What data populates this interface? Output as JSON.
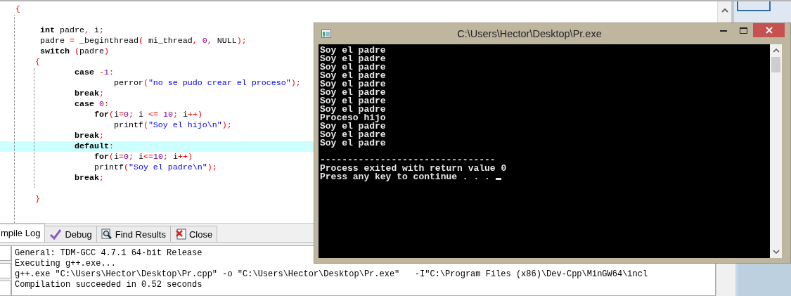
{
  "editor": {
    "lines": [
      {
        "current": false,
        "segments": [
          {
            "kind": "sym",
            "t": "{"
          }
        ]
      },
      {
        "current": false
      },
      {
        "current": false,
        "segments": [
          {
            "kind": "kw",
            "t": "     int"
          },
          {
            "kind": "id",
            "t": " padre"
          },
          {
            "kind": "sym",
            "t": ","
          },
          {
            "kind": "id",
            "t": " i"
          },
          {
            "kind": "sym",
            "t": ";"
          }
        ]
      },
      {
        "current": false,
        "segments": [
          {
            "kind": "id",
            "t": "     padre "
          },
          {
            "kind": "sym",
            "t": "="
          },
          {
            "kind": "id",
            "t": " _beginthread"
          },
          {
            "kind": "sym",
            "t": "("
          },
          {
            "kind": "id",
            "t": " mi_thread"
          },
          {
            "kind": "sym",
            "t": ","
          },
          {
            "kind": "num",
            "t": " 0"
          },
          {
            "kind": "sym",
            "t": ","
          },
          {
            "kind": "id",
            "t": " NULL"
          },
          {
            "kind": "sym",
            "t": ");"
          }
        ]
      },
      {
        "current": false,
        "segments": [
          {
            "kind": "kw",
            "t": "     switch"
          },
          {
            "kind": "sym",
            "t": " ("
          },
          {
            "kind": "id",
            "t": "padre"
          },
          {
            "kind": "sym",
            "t": ")"
          }
        ]
      },
      {
        "current": false,
        "segments": [
          {
            "kind": "sym",
            "t": "    {"
          }
        ]
      },
      {
        "current": false,
        "segments": [
          {
            "kind": "kw",
            "t": "            case"
          },
          {
            "kind": "sym",
            "t": " -"
          },
          {
            "kind": "num",
            "t": "1"
          },
          {
            "kind": "sym",
            "t": ":"
          }
        ]
      },
      {
        "current": false,
        "segments": [
          {
            "kind": "id",
            "t": "                    perror"
          },
          {
            "kind": "sym",
            "t": "("
          },
          {
            "kind": "str",
            "t": "\"no se pudo crear el proceso\""
          },
          {
            "kind": "sym",
            "t": ");"
          }
        ]
      },
      {
        "current": false,
        "segments": [
          {
            "kind": "kw",
            "t": "            break"
          },
          {
            "kind": "sym",
            "t": ";"
          }
        ]
      },
      {
        "current": false,
        "segments": [
          {
            "kind": "kw",
            "t": "            case"
          },
          {
            "kind": "num",
            "t": " 0"
          },
          {
            "kind": "sym",
            "t": ":"
          }
        ]
      },
      {
        "current": false,
        "segments": [
          {
            "kind": "kw",
            "t": "                for"
          },
          {
            "kind": "sym",
            "t": "("
          },
          {
            "kind": "id",
            "t": "i"
          },
          {
            "kind": "sym",
            "t": "="
          },
          {
            "kind": "num",
            "t": "0"
          },
          {
            "kind": "sym",
            "t": ";"
          },
          {
            "kind": "id",
            "t": " i "
          },
          {
            "kind": "sym",
            "t": "<="
          },
          {
            "kind": "num",
            "t": " 10"
          },
          {
            "kind": "sym",
            "t": ";"
          },
          {
            "kind": "id",
            "t": " i"
          },
          {
            "kind": "sym",
            "t": "++)"
          }
        ]
      },
      {
        "current": false,
        "segments": [
          {
            "kind": "id",
            "t": "                    printf"
          },
          {
            "kind": "sym",
            "t": "("
          },
          {
            "kind": "str",
            "t": "\"Soy el hijo\\n\""
          },
          {
            "kind": "sym",
            "t": ");"
          }
        ]
      },
      {
        "current": false,
        "segments": [
          {
            "kind": "kw",
            "t": "            break"
          },
          {
            "kind": "sym",
            "t": ";"
          }
        ]
      },
      {
        "current": true,
        "segments": [
          {
            "kind": "kw",
            "t": "            default"
          },
          {
            "kind": "sym",
            "t": ":"
          }
        ]
      },
      {
        "current": false,
        "segments": [
          {
            "kind": "kw",
            "t": "                for"
          },
          {
            "kind": "sym",
            "t": "("
          },
          {
            "kind": "id",
            "t": "i"
          },
          {
            "kind": "sym",
            "t": "="
          },
          {
            "kind": "num",
            "t": "0"
          },
          {
            "kind": "sym",
            "t": ";"
          },
          {
            "kind": "id",
            "t": " i"
          },
          {
            "kind": "sym",
            "t": "<="
          },
          {
            "kind": "num",
            "t": "10"
          },
          {
            "kind": "sym",
            "t": ";"
          },
          {
            "kind": "id",
            "t": " i"
          },
          {
            "kind": "sym",
            "t": "++)"
          }
        ]
      },
      {
        "current": false,
        "segments": [
          {
            "kind": "id",
            "t": "                printf"
          },
          {
            "kind": "sym",
            "t": "("
          },
          {
            "kind": "str",
            "t": "\"Soy el padre\\n\""
          },
          {
            "kind": "sym",
            "t": ");"
          }
        ]
      },
      {
        "current": false,
        "segments": [
          {
            "kind": "kw",
            "t": "            break"
          },
          {
            "kind": "sym",
            "t": ";"
          }
        ]
      },
      {
        "current": false
      },
      {
        "current": false,
        "segments": [
          {
            "kind": "sym",
            "t": "    }"
          }
        ]
      }
    ]
  },
  "bottom_panel": {
    "tabs": [
      {
        "label": "mpile Log",
        "selected": true
      },
      {
        "label": "Debug",
        "selected": false
      },
      {
        "label": "Find Results",
        "selected": false
      },
      {
        "label": "Close",
        "selected": false
      }
    ],
    "log": [
      "General: TDM-GCC 4.7.1 64-bit Release",
      "Executing g++.exe...",
      "g++.exe \"C:\\Users\\Hector\\Desktop\\Pr.cpp\" -o \"C:\\Users\\Hector\\Desktop\\Pr.exe\"   -I\"C:\\Program Files (x86)\\Dev-Cpp\\MinGW64\\incl",
      "Compilation succeeded in 0.52 seconds"
    ]
  },
  "console": {
    "title": "C:\\Users\\Hector\\Desktop\\Pr.exe",
    "lines": [
      "Soy el padre",
      "Soy el padre",
      "Soy el padre",
      "Soy el padre",
      "Soy el padre",
      "Soy el padre",
      "Soy el padre",
      "Soy el padre",
      "Proceso hijo",
      "Soy el padre",
      "Soy el padre",
      "Soy el padre"
    ],
    "footer_lines": [
      "--------------------------------",
      "Process exited with return value 0",
      "Press any key to continue . . ."
    ]
  }
}
